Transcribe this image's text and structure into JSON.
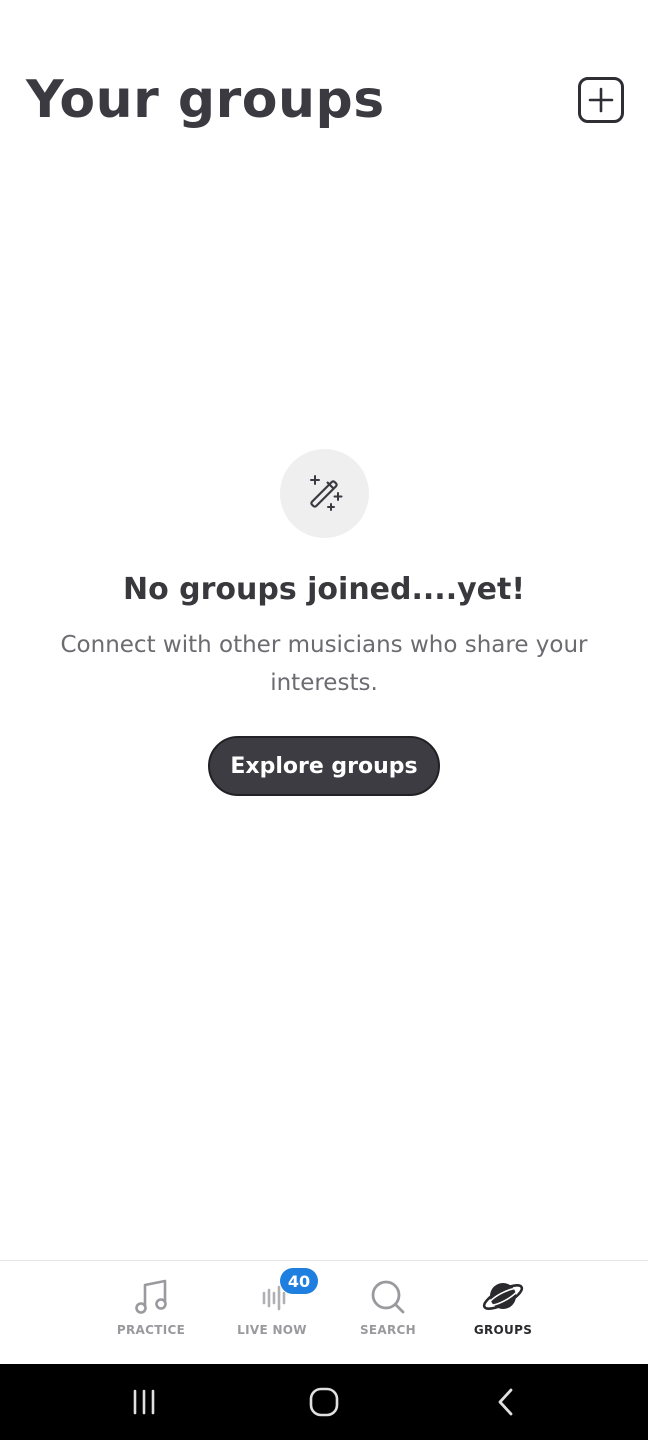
{
  "header": {
    "title": "Your groups",
    "add_icon": "plus-square-icon"
  },
  "empty_state": {
    "icon": "magic-wand-icon",
    "title": "No groups joined....yet!",
    "subtitle": "Connect with other musicians who share your interests.",
    "button_label": "Explore groups"
  },
  "tabbar": {
    "tabs": [
      {
        "label": "PRACTICE",
        "icon": "music-note-icon",
        "active": false
      },
      {
        "label": "LIVE NOW",
        "icon": "sound-wave-icon",
        "active": false,
        "badge": "40"
      },
      {
        "label": "SEARCH",
        "icon": "search-icon",
        "active": false
      },
      {
        "label": "GROUPS",
        "icon": "planet-icon",
        "active": true
      }
    ]
  },
  "system_nav": {
    "buttons": [
      "recents-icon",
      "home-icon",
      "back-icon"
    ]
  },
  "colors": {
    "badge": "#1f7fe0",
    "button_bg": "#3c3c42",
    "text": "#3a3a40"
  }
}
